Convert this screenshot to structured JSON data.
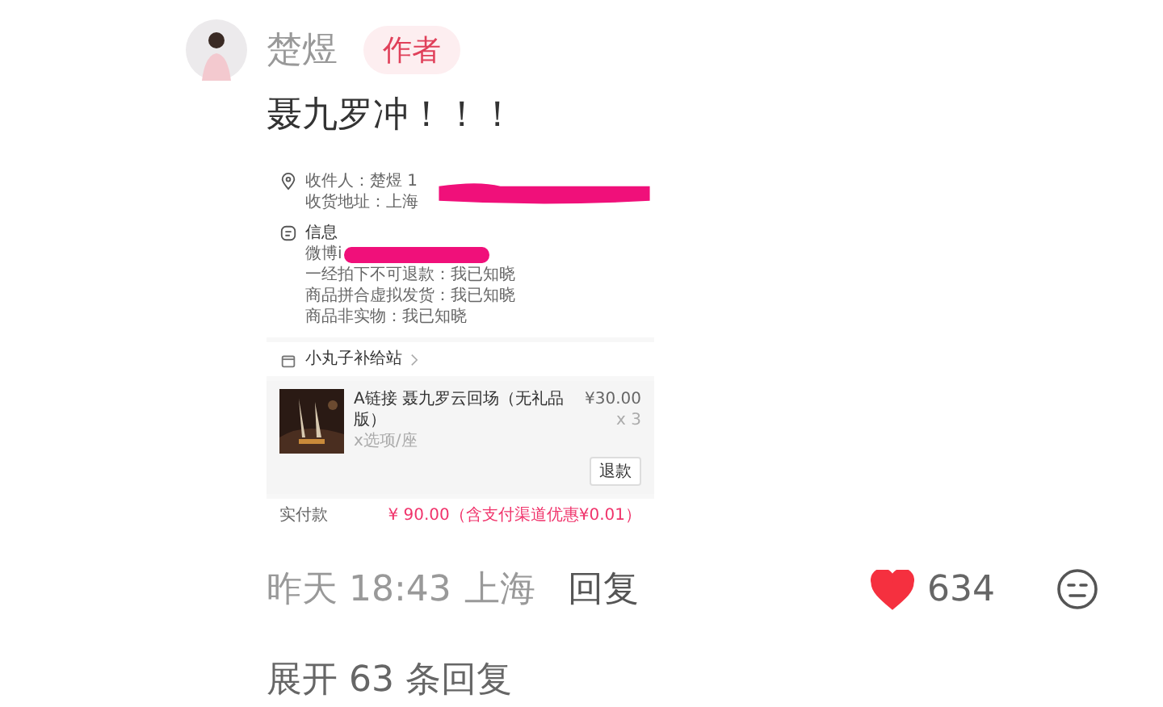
{
  "comment": {
    "author": "楚煜",
    "badge": "作者",
    "text": "聂九罗冲！！！",
    "attachment": {
      "address_lines": [
        "收件人：楚煜 1",
        "收货地址：上海"
      ],
      "info_title": "信息",
      "info_lines": [
        "微博i",
        "一经拍下不可退款：我已知晓",
        "商品拼合虚拟发货：我已知晓",
        "商品非实物：我已知晓"
      ],
      "shop": "小丸子补给站",
      "product": {
        "kind": "picture",
        "title": "A链接 聂九罗云回场（无礼品版）",
        "variant": "x选项/座",
        "price": "¥30.00",
        "quantity": "x 3",
        "action": "退款"
      },
      "total_label": "实付款",
      "total": "¥ 90.00（含支付渠道优惠¥0.01）"
    },
    "time": "昨天 18:43",
    "location": "上海",
    "reply_label": "回复",
    "likes": "634",
    "liked": true
  },
  "expand_replies": "展开 63 条回复"
}
